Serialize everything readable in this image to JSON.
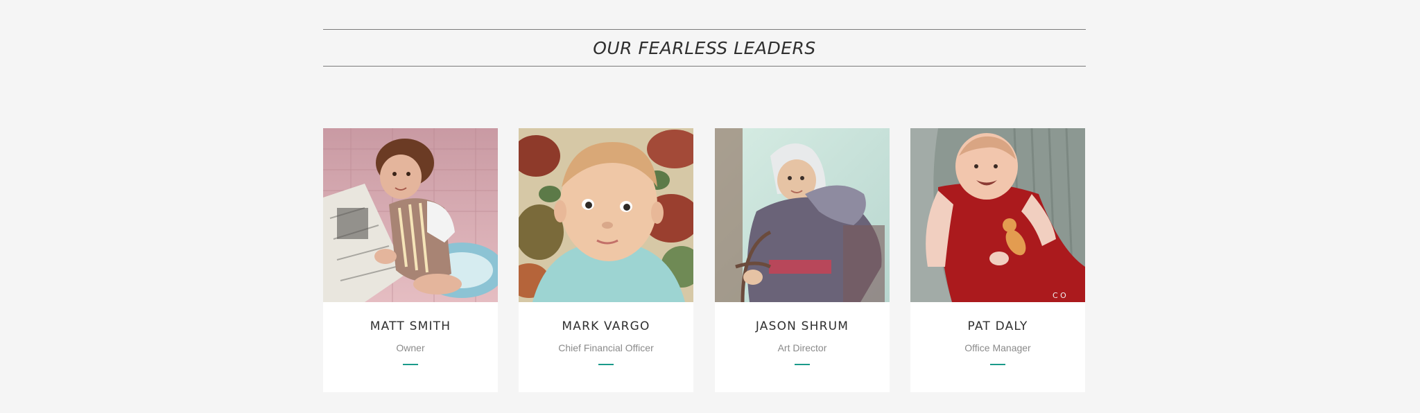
{
  "section": {
    "title": "OUR FEARLESS LEADERS"
  },
  "colors": {
    "background": "#f5f5f5",
    "card": "#ffffff",
    "accent": "#1a9a8a",
    "title_text": "#2f2f2f",
    "role_text": "#8a8a8a"
  },
  "team": [
    {
      "name": "MATT SMITH",
      "role": "Owner"
    },
    {
      "name": "MARK VARGO",
      "role": "Chief Financial Officer"
    },
    {
      "name": "JASON SHRUM",
      "role": "Art Director"
    },
    {
      "name": "PAT DALY",
      "role": "Office Manager"
    }
  ]
}
